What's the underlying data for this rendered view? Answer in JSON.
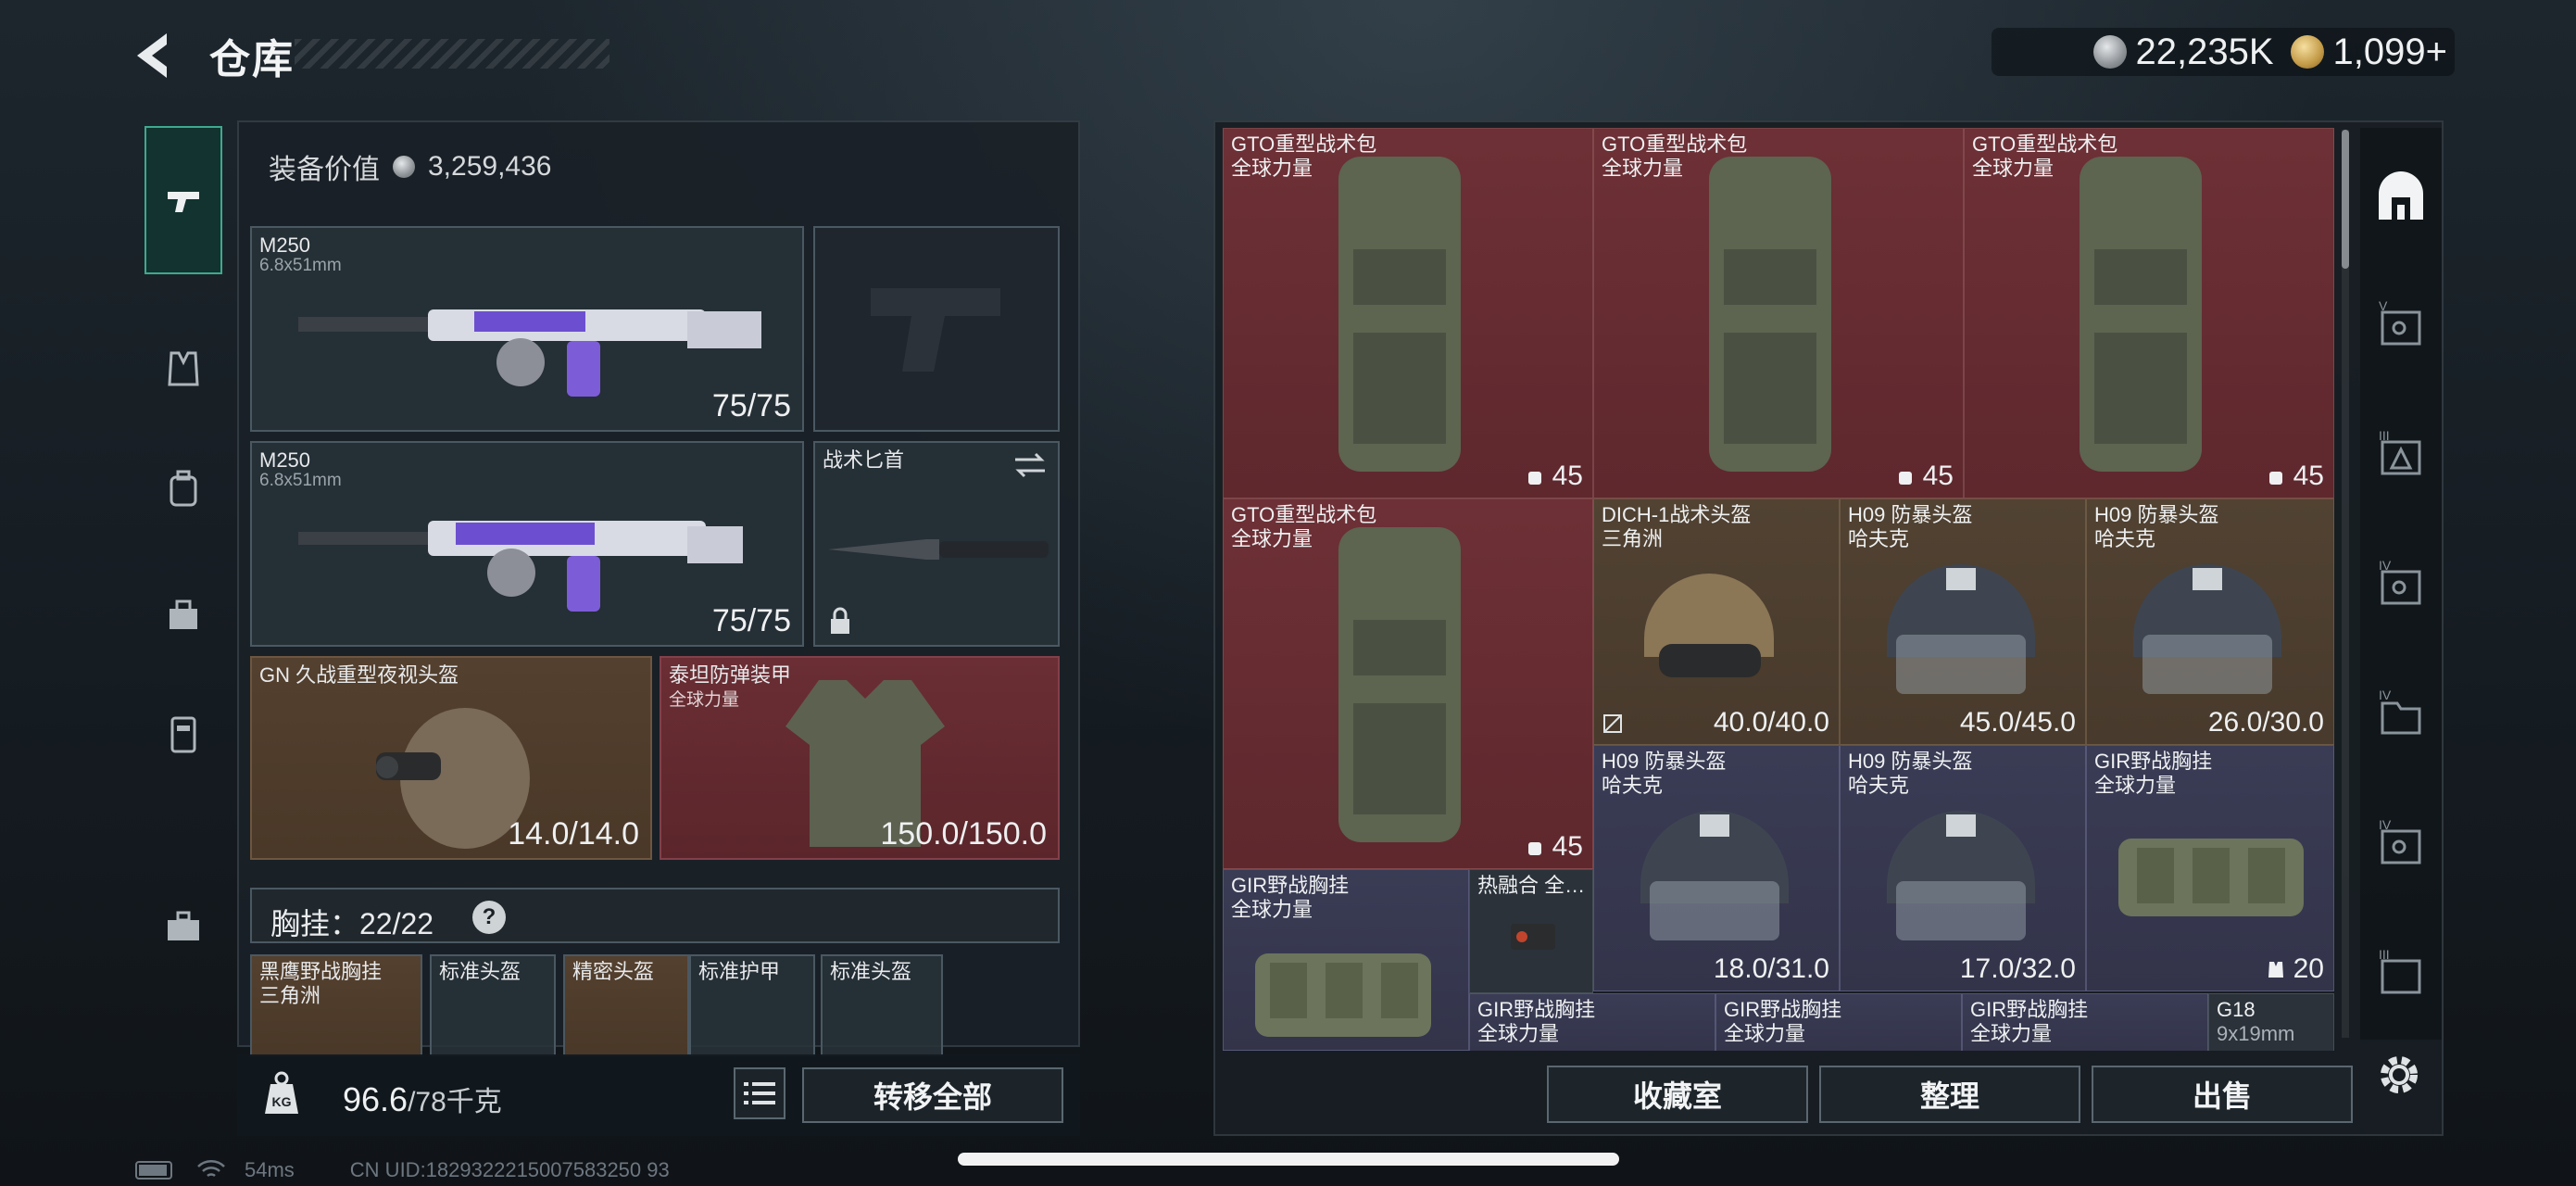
{
  "header": {
    "title": "仓库"
  },
  "currency": {
    "silver": "22,235K",
    "gold": "1,099+"
  },
  "loadout": {
    "equip_value_label": "装备价值",
    "equip_value": "3,259,436",
    "primary1": {
      "name": "M250",
      "caliber": "6.8x51mm",
      "ammo": "75/75"
    },
    "primary2": {
      "name": "M250",
      "caliber": "6.8x51mm",
      "ammo": "75/75"
    },
    "melee": {
      "name": "战术匕首"
    },
    "helmet": {
      "name": "GN 久战重型夜视头盔",
      "durability": "14.0/14.0"
    },
    "armor": {
      "name": "泰坦防弹装甲",
      "sub": "全球力量",
      "durability": "150.0/150.0"
    },
    "vest_label": "胸挂：22/22",
    "vest_help": "?",
    "vest_items": [
      "黑鹰野战胸挂",
      "标准头盔",
      "精密头盔",
      "标准护甲",
      "标准头盔"
    ],
    "vest_sub": "三角洲",
    "weight": "96.6",
    "weight_unit": "/78千克",
    "kg_label": "KG",
    "transfer_all": "转移全部"
  },
  "storage": {
    "items": [
      {
        "name": "GTO重型战术包",
        "sub": "全球力量",
        "val": "45"
      },
      {
        "name": "GTO重型战术包",
        "sub": "全球力量",
        "val": "45"
      },
      {
        "name": "GTO重型战术包",
        "sub": "全球力量",
        "val": "45"
      },
      {
        "name": "GTO重型战术包",
        "sub": "全球力量",
        "val": "45"
      },
      {
        "name": "DICH-1战术头盔",
        "sub": "三角洲",
        "val": "40.0/40.0"
      },
      {
        "name": "H09 防暴头盔",
        "sub": "哈夫克",
        "val": "45.0/45.0"
      },
      {
        "name": "H09 防暴头盔",
        "sub": "哈夫克",
        "val": "26.0/30.0"
      },
      {
        "name": "H09 防暴头盔",
        "sub": "哈夫克",
        "val": "18.0/31.0"
      },
      {
        "name": "H09 防暴头盔",
        "sub": "哈夫克",
        "val": "17.0/32.0"
      },
      {
        "name": "GIR野战胸挂",
        "sub": "全球力量",
        "val": "20"
      },
      {
        "name": "GIR野战胸挂",
        "sub": "全球力量",
        "val": ""
      },
      {
        "name": "热融合 全…",
        "sub": "",
        "val": ""
      },
      {
        "name": "GIR野战胸挂",
        "sub": "全球力量",
        "val": ""
      },
      {
        "name": "GIR野战胸挂",
        "sub": "全球力量",
        "val": ""
      },
      {
        "name": "GIR野战胸挂",
        "sub": "全球力量",
        "val": ""
      },
      {
        "name": "G18",
        "sub": "9x19mm",
        "val": ""
      }
    ],
    "buttons": {
      "collection": "收藏室",
      "organize": "整理",
      "sell": "出售"
    },
    "tab_labels": [
      "V",
      "III",
      "IV",
      "IV",
      "IV",
      "III"
    ]
  },
  "status_bar": {
    "ping": "54ms",
    "uid": "CN UID:1829322215007583250 93"
  }
}
